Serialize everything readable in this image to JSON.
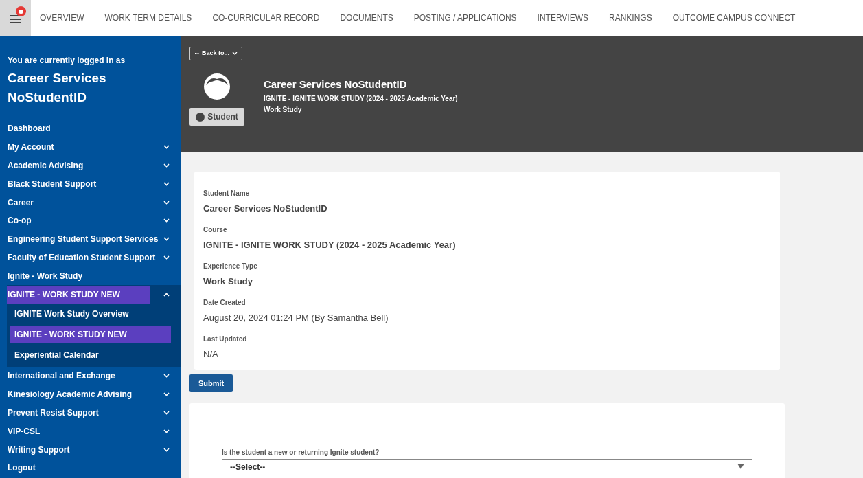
{
  "top_nav": {
    "tabs": [
      {
        "label": "OVERVIEW",
        "selected": false
      },
      {
        "label": "WORK TERM DETAILS",
        "selected": false
      },
      {
        "label": "CO-CURRICULAR RECORD",
        "selected": false
      },
      {
        "label": "DOCUMENTS",
        "selected": false
      },
      {
        "label": "POSTING / APPLICATIONS",
        "selected": false
      },
      {
        "label": "INTERVIEWS",
        "selected": false
      },
      {
        "label": "RANKINGS",
        "selected": false
      },
      {
        "label": "OUTCOME CAMPUS CONNECT",
        "selected": false
      }
    ]
  },
  "sidebar": {
    "logged_in_label": "You are currently logged in as",
    "user_name": "Career Services NoStudentID",
    "items": [
      {
        "label": "Dashboard",
        "kind": "link",
        "selected": false
      },
      {
        "label": "My Account",
        "kind": "group",
        "expanded": false,
        "selected": false
      },
      {
        "label": "Academic Advising",
        "kind": "group",
        "expanded": false,
        "selected": false
      },
      {
        "label": "Black Student Support",
        "kind": "group",
        "expanded": false,
        "selected": false
      },
      {
        "label": "Career",
        "kind": "group",
        "expanded": false,
        "selected": false
      },
      {
        "label": "Co-op",
        "kind": "group",
        "expanded": false,
        "selected": false
      },
      {
        "label": "Engineering Student Support Services",
        "kind": "group",
        "expanded": false,
        "selected": false
      },
      {
        "label": "Faculty of Education Student Support",
        "kind": "group",
        "expanded": false,
        "selected": false
      },
      {
        "label": "Ignite - Work Study",
        "kind": "link",
        "selected": false
      },
      {
        "label": "IGNITE - WORK STUDY NEW",
        "kind": "group",
        "expanded": true,
        "selected": true,
        "children": [
          {
            "label": "IGNITE Work Study Overview",
            "selected": false
          },
          {
            "label": "IGNITE - WORK STUDY NEW",
            "selected": true
          },
          {
            "label": "Experiential Calendar",
            "selected": false
          }
        ]
      },
      {
        "label": "International and Exchange",
        "kind": "group",
        "expanded": false,
        "selected": false
      },
      {
        "label": "Kinesiology Academic Advising",
        "kind": "group",
        "expanded": false,
        "selected": false
      },
      {
        "label": "Prevent Resist Support",
        "kind": "group",
        "expanded": false,
        "selected": false
      },
      {
        "label": "VIP-CSL",
        "kind": "group",
        "expanded": false,
        "selected": false
      },
      {
        "label": "Writing Support",
        "kind": "group",
        "expanded": false,
        "selected": false
      },
      {
        "label": "Logout",
        "kind": "link",
        "selected": false
      }
    ]
  },
  "header": {
    "back_button": "Back to...",
    "role_badge": "Student",
    "name": "Career Services NoStudentID",
    "course": "IGNITE - IGNITE WORK STUDY (2024 - 2025 Academic Year)",
    "experience": "Work Study"
  },
  "details": [
    {
      "label": "Student Name",
      "value": "Career Services NoStudentID",
      "kind": "strong"
    },
    {
      "label": "Course",
      "value": "IGNITE - IGNITE WORK STUDY (2024 - 2025 Academic Year)",
      "kind": "strong"
    },
    {
      "label": "Experience Type",
      "value": "Work Study",
      "kind": "strong"
    },
    {
      "label": "Date Created",
      "value": "August 20, 2024 01:24 PM (By Samantha Bell)",
      "kind": "plain"
    },
    {
      "label": "Last Updated",
      "value": "N/A",
      "kind": "plain"
    }
  ],
  "submit_button": "Submit",
  "form": {
    "question": "Is the student a new or returning Ignite student?",
    "select_value": "--Select--"
  }
}
